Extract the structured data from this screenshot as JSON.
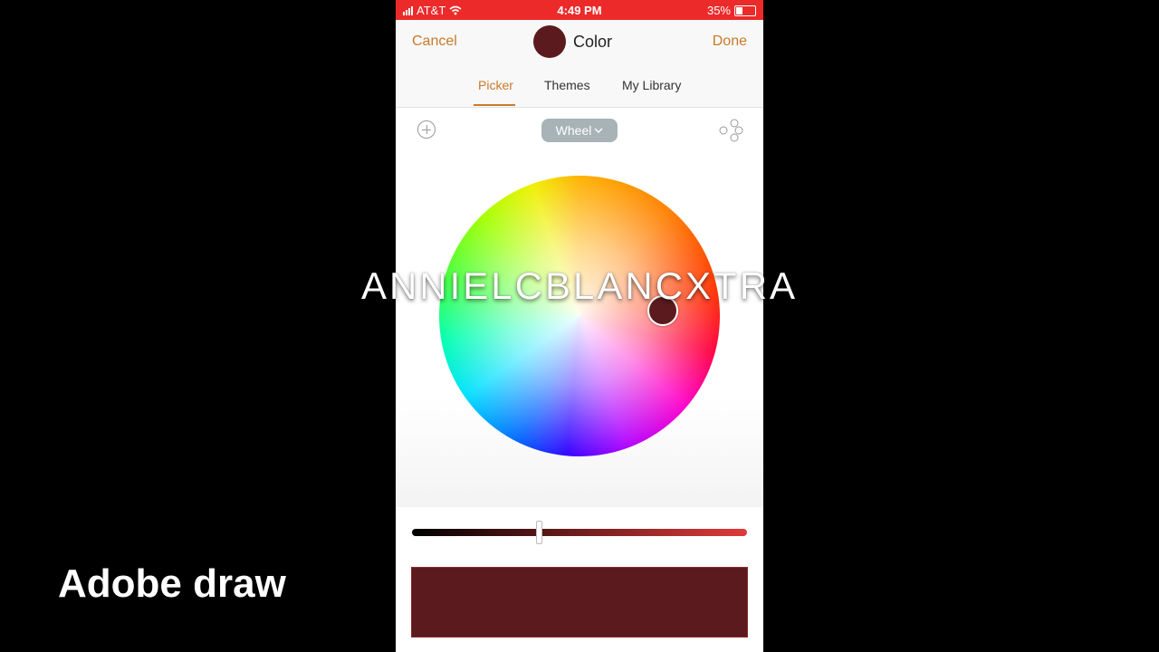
{
  "statusbar": {
    "carrier": "AT&T",
    "time": "4:49 PM",
    "battery": "35%",
    "battery_level": 0.35
  },
  "nav": {
    "cancel": "Cancel",
    "title": "Color",
    "done": "Done"
  },
  "tabs": [
    {
      "label": "Picker",
      "active": true
    },
    {
      "label": "Themes",
      "active": false
    },
    {
      "label": "My Library",
      "active": false
    }
  ],
  "toolbar": {
    "mode": "Wheel",
    "add_icon": "plus-circle-icon",
    "share_icon": "share-nodes-icon"
  },
  "brightness": 0.38,
  "selected_color": "#5a1a1e",
  "colors": {
    "accent": "#c87a2a",
    "status_bar": "#ec2a2a",
    "slider_end": "#e03a3a"
  },
  "overlay": {
    "watermark": "ANNIELCBLANCXTRA",
    "caption": "Adobe draw"
  }
}
